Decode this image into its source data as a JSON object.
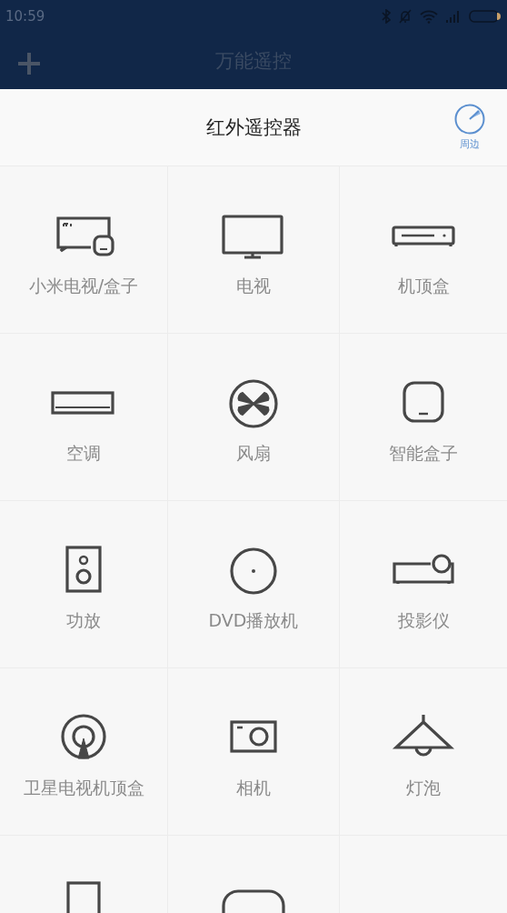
{
  "status_bar": {
    "time": "10:59"
  },
  "header": {
    "title": "万能遥控"
  },
  "section": {
    "title": "红外遥控器",
    "nearby_label": "周边"
  },
  "devices": [
    {
      "kind": "mitv",
      "label": "小米电视/盒子"
    },
    {
      "kind": "tv",
      "label": "电视"
    },
    {
      "kind": "stb",
      "label": "机顶盒"
    },
    {
      "kind": "ac",
      "label": "空调"
    },
    {
      "kind": "fan",
      "label": "风扇"
    },
    {
      "kind": "box",
      "label": "智能盒子"
    },
    {
      "kind": "amp",
      "label": "功放"
    },
    {
      "kind": "dvd",
      "label": "DVD播放机"
    },
    {
      "kind": "projector",
      "label": "投影仪"
    },
    {
      "kind": "satellite",
      "label": "卫星电视机顶盒"
    },
    {
      "kind": "camera",
      "label": "相机"
    },
    {
      "kind": "lamp",
      "label": "灯泡"
    },
    {
      "kind": "tablet"
    },
    {
      "kind": "pill"
    },
    {
      "kind": "empty"
    }
  ]
}
